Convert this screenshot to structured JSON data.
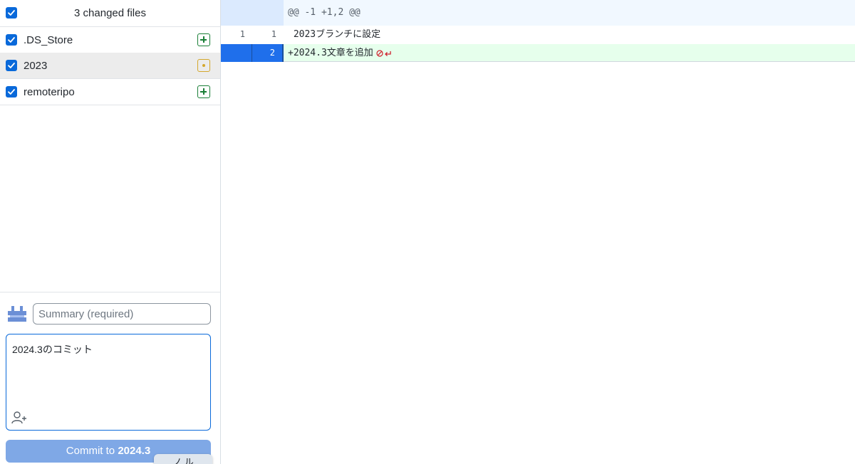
{
  "colors": {
    "accent": "#0969da",
    "added": "#1a7f37",
    "modified": "#d4a72c",
    "addition_bg": "#e6ffec",
    "hunk_bg": "#f1f8ff"
  },
  "changes": {
    "header": "3 changed files",
    "files": [
      {
        "name": ".DS_Store",
        "status": "added",
        "checked": true
      },
      {
        "name": "2023",
        "status": "modified",
        "checked": true
      },
      {
        "name": "remoteripo",
        "status": "added",
        "checked": true
      }
    ]
  },
  "commit": {
    "summary_placeholder": "Summary (required)",
    "description": "2024.3のコミット",
    "button_prefix": "Commit to ",
    "branch": "2024.3",
    "tooltip_text": "ノ ル"
  },
  "diff": {
    "hunk_header": "@@ -1 +1,2 @@",
    "lines": [
      {
        "old": "1",
        "new": "1",
        "text": " 2023ブランチに設定",
        "type": "context"
      },
      {
        "old": "",
        "new": "2",
        "text": "+2024.3文章を追加",
        "type": "addition"
      }
    ]
  }
}
